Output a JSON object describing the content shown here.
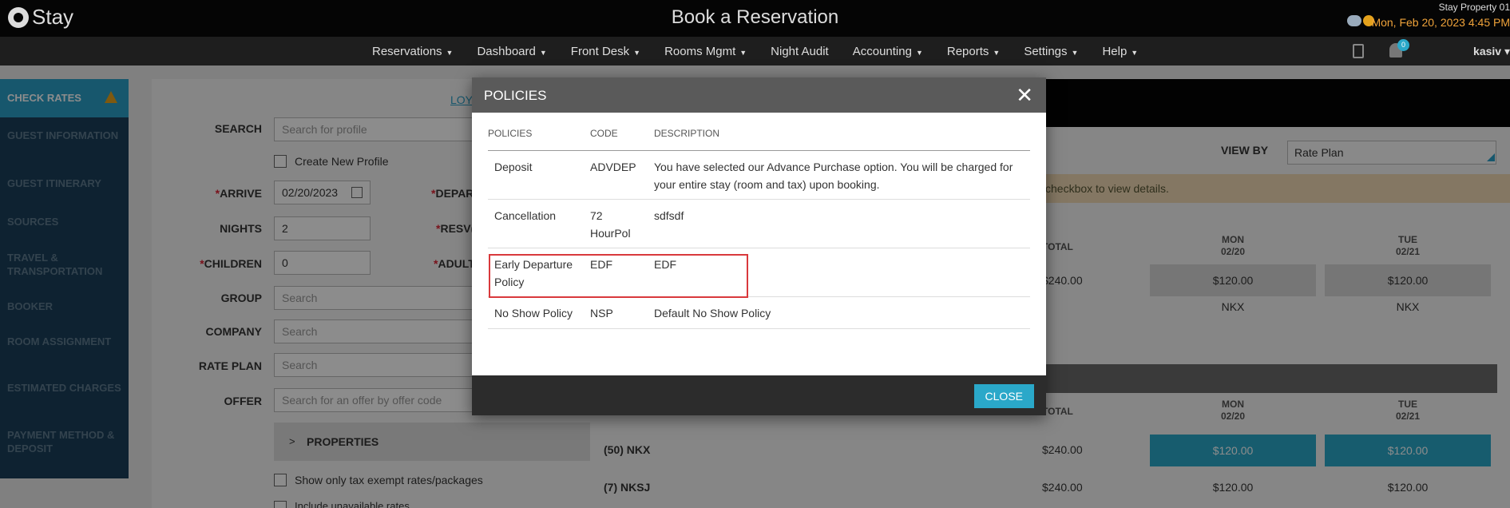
{
  "app": {
    "logo": "Stay",
    "title": "Book a Reservation",
    "property": "Stay Property 01",
    "datetime": "Mon, Feb 20, 2023 4:45 PM",
    "user": "kasiv",
    "notification_count": "0"
  },
  "nav": [
    "Reservations",
    "Dashboard",
    "Front Desk",
    "Rooms Mgmt",
    "Night Audit",
    "Accounting",
    "Reports",
    "Settings",
    "Help"
  ],
  "sidebar": {
    "items": [
      "CHECK RATES",
      "GUEST INFORMATION",
      "GUEST ITINERARY",
      "SOURCES",
      "TRAVEL & TRANSPORTATION",
      "BOOKER",
      "ROOM ASSIGNMENT",
      "ESTIMATED CHARGES",
      "PAYMENT METHOD & DEPOSIT"
    ]
  },
  "form": {
    "loyalty": "LOY/",
    "search_label": "SEARCH",
    "search_placeholder": "Search for profile",
    "create_profile": "Create New Profile",
    "arrive_label": "ARRIVE",
    "arrive_value": "02/20/2023",
    "depart_label": "DEPAR",
    "nights_label": "NIGHTS",
    "nights_value": "2",
    "resv_label": "RESV(",
    "children_label": "CHILDREN",
    "children_value": "0",
    "adults_label": "ADULT",
    "group_label": "GROUP",
    "group_placeholder": "Search",
    "company_label": "COMPANY",
    "company_placeholder": "Search",
    "rateplan_label": "RATE PLAN",
    "rateplan_placeholder": "Search",
    "offer_label": "OFFER",
    "offer_placeholder": "Search for an offer by offer code",
    "properties": "PROPERTIES",
    "tax_exempt": "Show only tax exempt rates/packages",
    "unavailable": "Include unavailable rates"
  },
  "rates": {
    "view_by_label": "VIEW BY",
    "view_by_value": "Rate Plan",
    "banner": "checkbox to view details.",
    "total_label": "TOTAL",
    "day1": {
      "dow": "MON",
      "date": "02/20"
    },
    "day2": {
      "dow": "TUE",
      "date": "02/21"
    },
    "top_total": "$240.00",
    "top_rate1": "$120.00",
    "top_rate2": "$120.00",
    "top_code1": "NKX",
    "top_code2": "NKX",
    "rows": [
      {
        "label": "(50)  NKX",
        "total": "$240.00",
        "rate1": "$120.00",
        "rate2": "$120.00"
      },
      {
        "label": "(7)  NKSJ",
        "total": "$240.00",
        "rate1": "$120.00",
        "rate2": "$120.00"
      }
    ]
  },
  "modal": {
    "title": "POLICIES",
    "close_label": "CLOSE",
    "columns": [
      "POLICIES",
      "CODE",
      "DESCRIPTION"
    ],
    "rows": [
      {
        "policy": "Deposit",
        "code": "ADVDEP",
        "description": "You have selected our Advance Purchase option. You will be charged for your entire stay (room and tax) upon booking."
      },
      {
        "policy": "Cancellation",
        "code": "72 HourPol",
        "description": "sdfsdf"
      },
      {
        "policy": "Early Departure Policy",
        "code": "EDF",
        "description": "EDF"
      },
      {
        "policy": "No Show Policy",
        "code": "NSP",
        "description": "Default No Show Policy"
      }
    ]
  },
  "colors": {
    "accent": "#2aa8c9",
    "highlight": "#d9393c",
    "sidebar": "#1a3f5a"
  }
}
